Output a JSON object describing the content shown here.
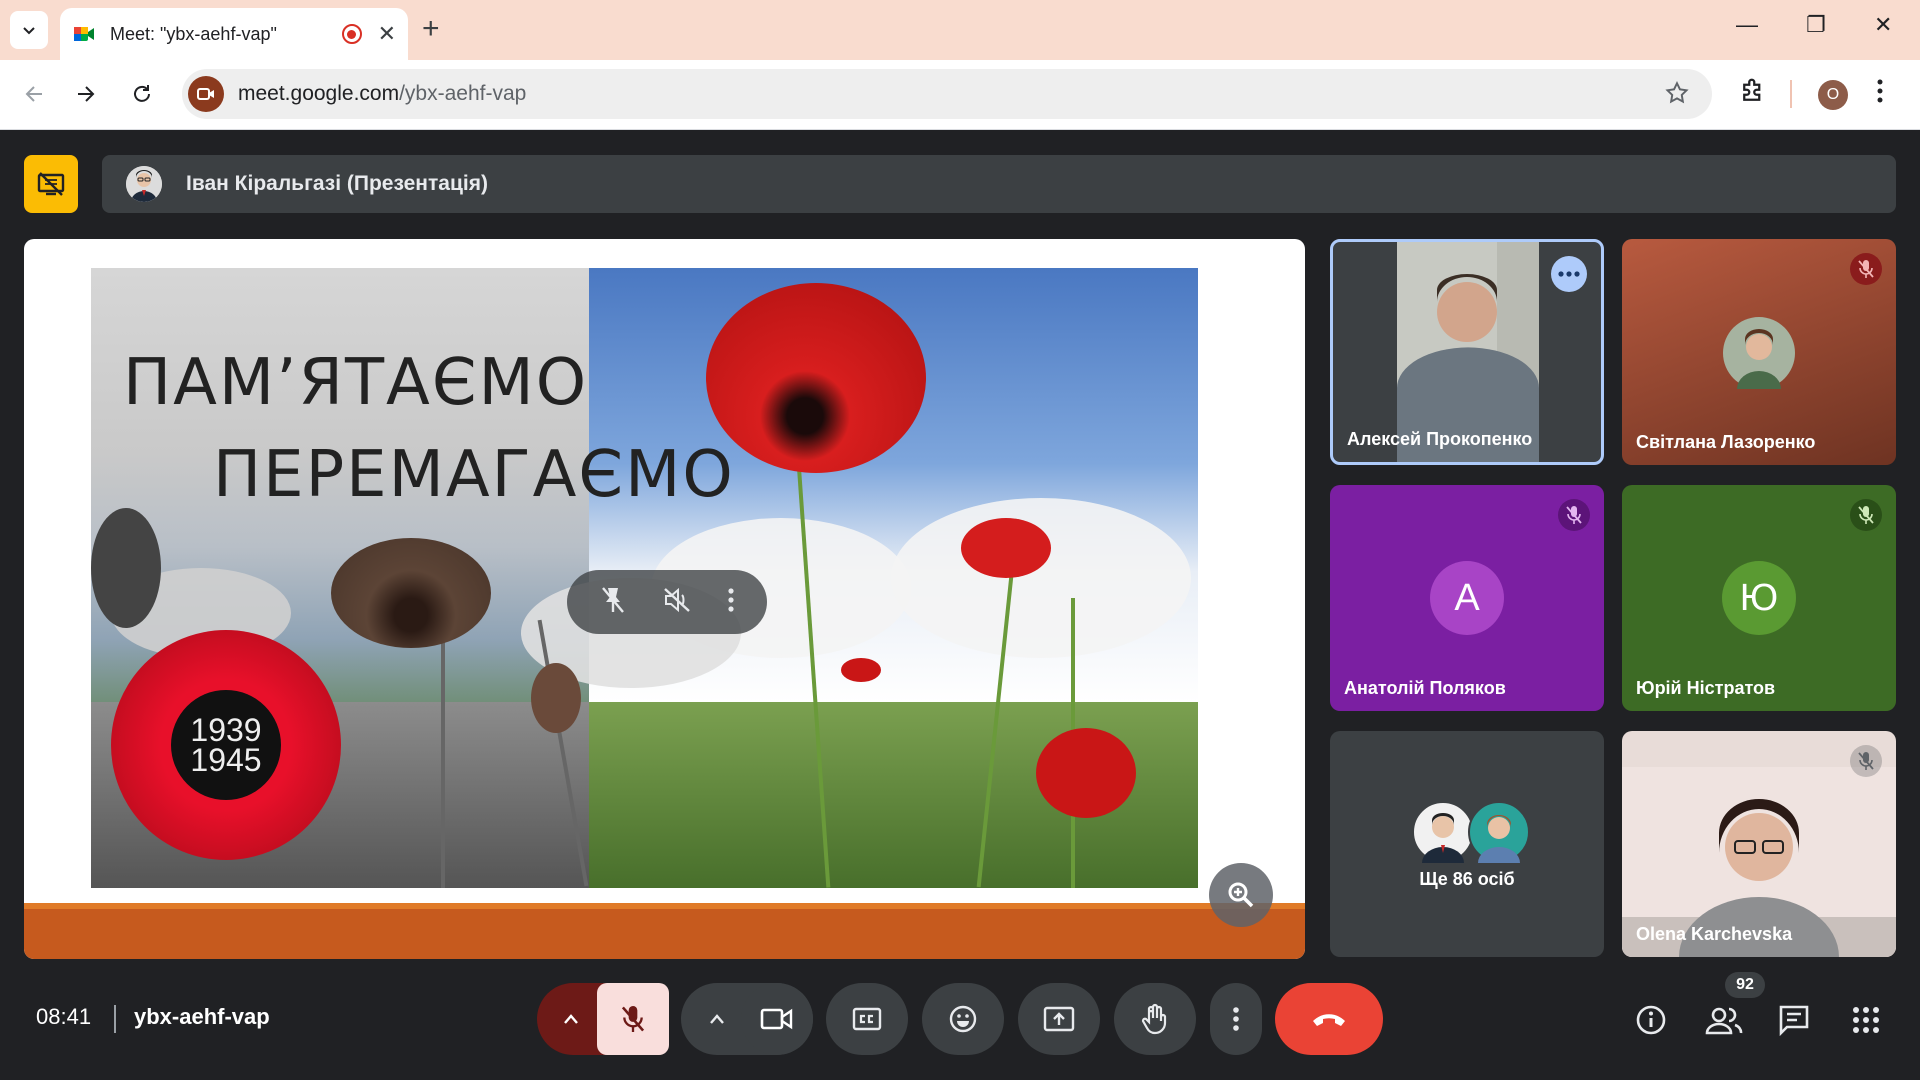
{
  "browser": {
    "tab_title": "Meet: \"ybx-aehf-vap\"",
    "url_host": "meet.google.com",
    "url_path": "/ybx-aehf-vap",
    "profile_initial": "O",
    "new_tab_symbol": "+",
    "close_symbol": "✕",
    "minimize_symbol": "—",
    "maximize_symbol": "❐",
    "window_close_symbol": "✕"
  },
  "presentation": {
    "presenter_label": "Іван Кіральгазі (Презентація)",
    "slide": {
      "line1": "ПАМ’ЯТАЄМО",
      "line2": "ПЕРЕМАГАЄМО",
      "year1": "1939",
      "year2": "1945"
    }
  },
  "participants": [
    {
      "name": "Алексей Прокопенко",
      "type": "video",
      "active": true
    },
    {
      "name": "Світлана Лазоренко",
      "type": "photo",
      "muted": true,
      "bg": "#8b4a35"
    },
    {
      "name": "Анатолій Поляков",
      "type": "letter",
      "letter": "A",
      "muted": true,
      "bg": "#7b1fa2",
      "avatar_bg": "#a844c6"
    },
    {
      "name": "Юрій Ністратов",
      "type": "letter",
      "letter": "Ю",
      "muted": true,
      "bg": "#3d6b25",
      "avatar_bg": "#5a9a32"
    },
    {
      "name": "Ще 86 осіб",
      "type": "more"
    },
    {
      "name": "Olena Karchevska",
      "type": "video",
      "muted": true
    }
  ],
  "bottom_bar": {
    "time": "08:41",
    "meeting_code": "ybx-aehf-vap",
    "people_count": "92"
  },
  "colors": {
    "accent_yellow": "#fbbc04",
    "hangup_red": "#ea4335",
    "active_tile_border": "#aecbfa",
    "tab_bar": "#f9dccf"
  }
}
